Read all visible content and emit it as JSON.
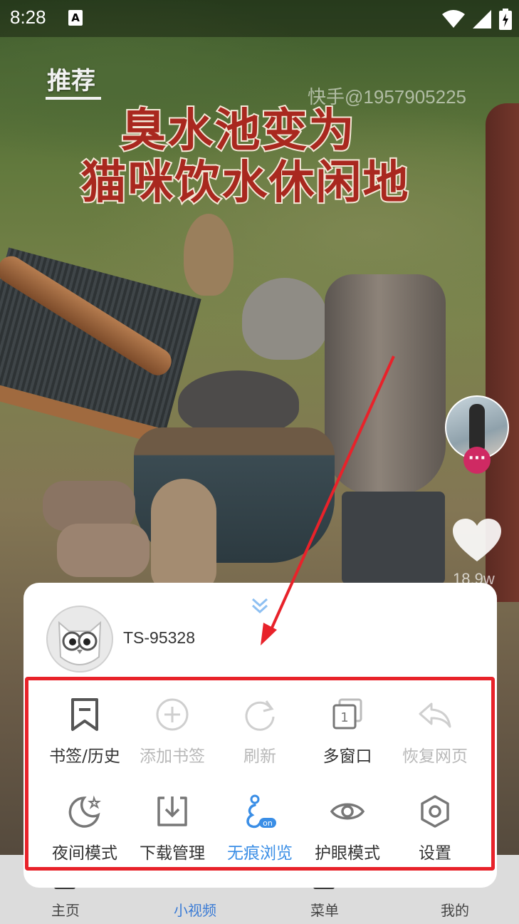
{
  "status_bar": {
    "time": "8:28",
    "keyboard_badge": "A"
  },
  "video": {
    "tab_label": "推荐",
    "watermark": "快手@1957905225",
    "headline_line1": "臭水池变为",
    "headline_line2": "猫咪饮水休闲地",
    "like_count": "18.9w",
    "more_label": "···"
  },
  "bottom_nav": {
    "items": [
      {
        "label": "主页"
      },
      {
        "label": "小视频"
      },
      {
        "label": "菜单"
      },
      {
        "label": "我的"
      }
    ]
  },
  "menu": {
    "username": "TS-95328",
    "row1": [
      {
        "label": "书签/历史",
        "icon": "bookmark-icon",
        "enabled": true
      },
      {
        "label": "添加书签",
        "icon": "add-circle-icon",
        "enabled": false
      },
      {
        "label": "刷新",
        "icon": "refresh-icon",
        "enabled": false
      },
      {
        "label": "多窗口",
        "icon": "multi-window-icon",
        "enabled": true
      },
      {
        "label": "恢复网页",
        "icon": "undo-icon",
        "enabled": false
      }
    ],
    "row2": [
      {
        "label": "夜间模式",
        "icon": "moon-icon",
        "enabled": true
      },
      {
        "label": "下载管理",
        "icon": "download-icon",
        "enabled": true
      },
      {
        "label": "无痕浏览",
        "icon": "incognito-icon",
        "enabled": true,
        "active": true,
        "badge": "on"
      },
      {
        "label": "护眼模式",
        "icon": "eye-icon",
        "enabled": true
      },
      {
        "label": "设置",
        "icon": "settings-hexagon-icon",
        "enabled": true
      }
    ],
    "window_count": "1"
  },
  "colors": {
    "accent_blue": "#3a8ee6",
    "annotation_red": "#e8222a",
    "disabled_gray": "#b8b8b8",
    "more_button_pink": "#cf2a63"
  }
}
